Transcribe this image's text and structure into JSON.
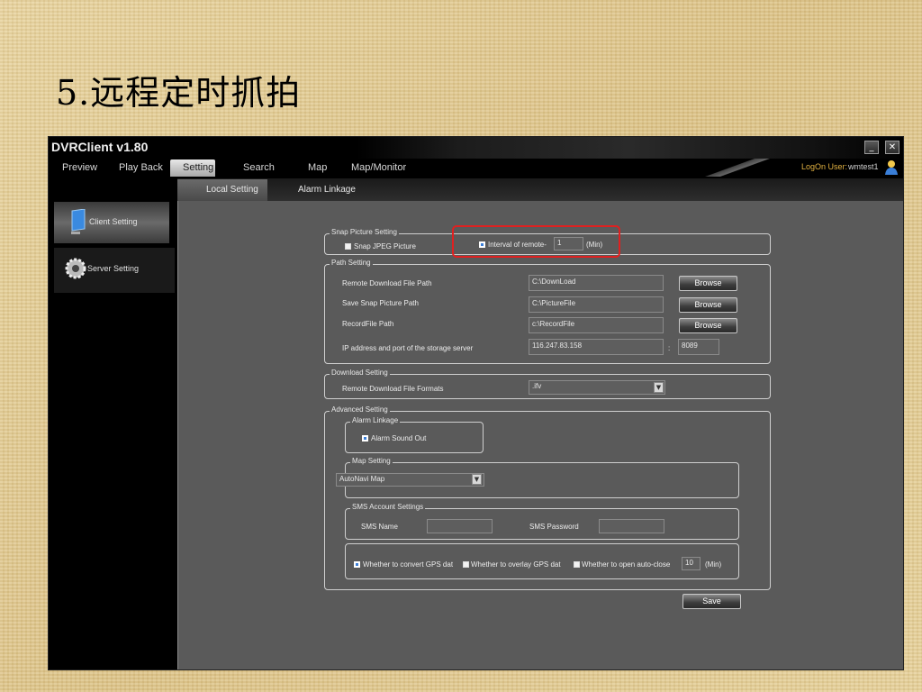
{
  "slide": {
    "title": "5.远程定时抓拍"
  },
  "window": {
    "title": "DVRClient v1.80",
    "minimize_glyph": "_",
    "close_glyph": "✕",
    "menu": [
      "Preview",
      "Play Back",
      "Setting",
      "Search",
      "Map",
      "Map/Monitor"
    ],
    "active_menu": "Setting",
    "logon_label": "LogOn User:",
    "logon_user": "wmtest1",
    "icons": {
      "user": "user-icon",
      "client": "monitor-icon",
      "server": "gear-icon"
    }
  },
  "subtabs": [
    "Local Setting",
    "Alarm Linkage"
  ],
  "active_subtab": "Local Setting",
  "sidebar": {
    "items": [
      {
        "label": "Client Setting"
      },
      {
        "label": "Server Setting"
      }
    ]
  },
  "snap": {
    "legend": "Snap Picture Setting",
    "jpeg_label": "Snap JPEG Picture",
    "jpeg_checked": false,
    "interval_label": "Interval of remote-",
    "interval_checked": true,
    "interval_value": "1",
    "interval_unit": "(Min)"
  },
  "path": {
    "legend": "Path Setting",
    "rows": [
      {
        "label": "Remote Download File Path",
        "value": "C:\\DownLoad",
        "button": "Browse"
      },
      {
        "label": "Save Snap Picture Path",
        "value": "C:\\PictureFile",
        "button": "Browse"
      },
      {
        "label": "RecordFile Path",
        "value": "c:\\RecordFile",
        "button": "Browse"
      }
    ],
    "ip_label": "IP address and port of the storage server",
    "ip_value": "116.247.83.158",
    "port_sep": ":",
    "port_value": "8089"
  },
  "download": {
    "legend": "Download Setting",
    "label": "Remote Download File Formats",
    "value": ".ifv"
  },
  "advanced": {
    "legend": "Advanced Setting",
    "alarm_legend": "Alarm Linkage",
    "alarm_sound_label": "Alarm Sound Out",
    "alarm_sound_checked": true,
    "map_legend": "Map Setting",
    "map_value": "AutoNavi Map",
    "sms_legend": "SMS Account Settings",
    "sms_name_label": "SMS Name",
    "sms_name_value": "",
    "sms_password_label": "SMS Password",
    "sms_password_value": "",
    "gps_convert_label": "Whether to convert GPS dat",
    "gps_convert_checked": true,
    "gps_overlay_label": "Whether to overlay GPS dat",
    "gps_overlay_checked": false,
    "auto_close_label": "Whether to open auto-close",
    "auto_close_checked": false,
    "auto_close_value": "10",
    "auto_close_unit": "(Min)"
  },
  "save_label": "Save",
  "select_arrow": "▼",
  "colors": {
    "highlight": "#e02020",
    "check_blue": "#3c7fd8",
    "logon_label": "#e0b040"
  }
}
